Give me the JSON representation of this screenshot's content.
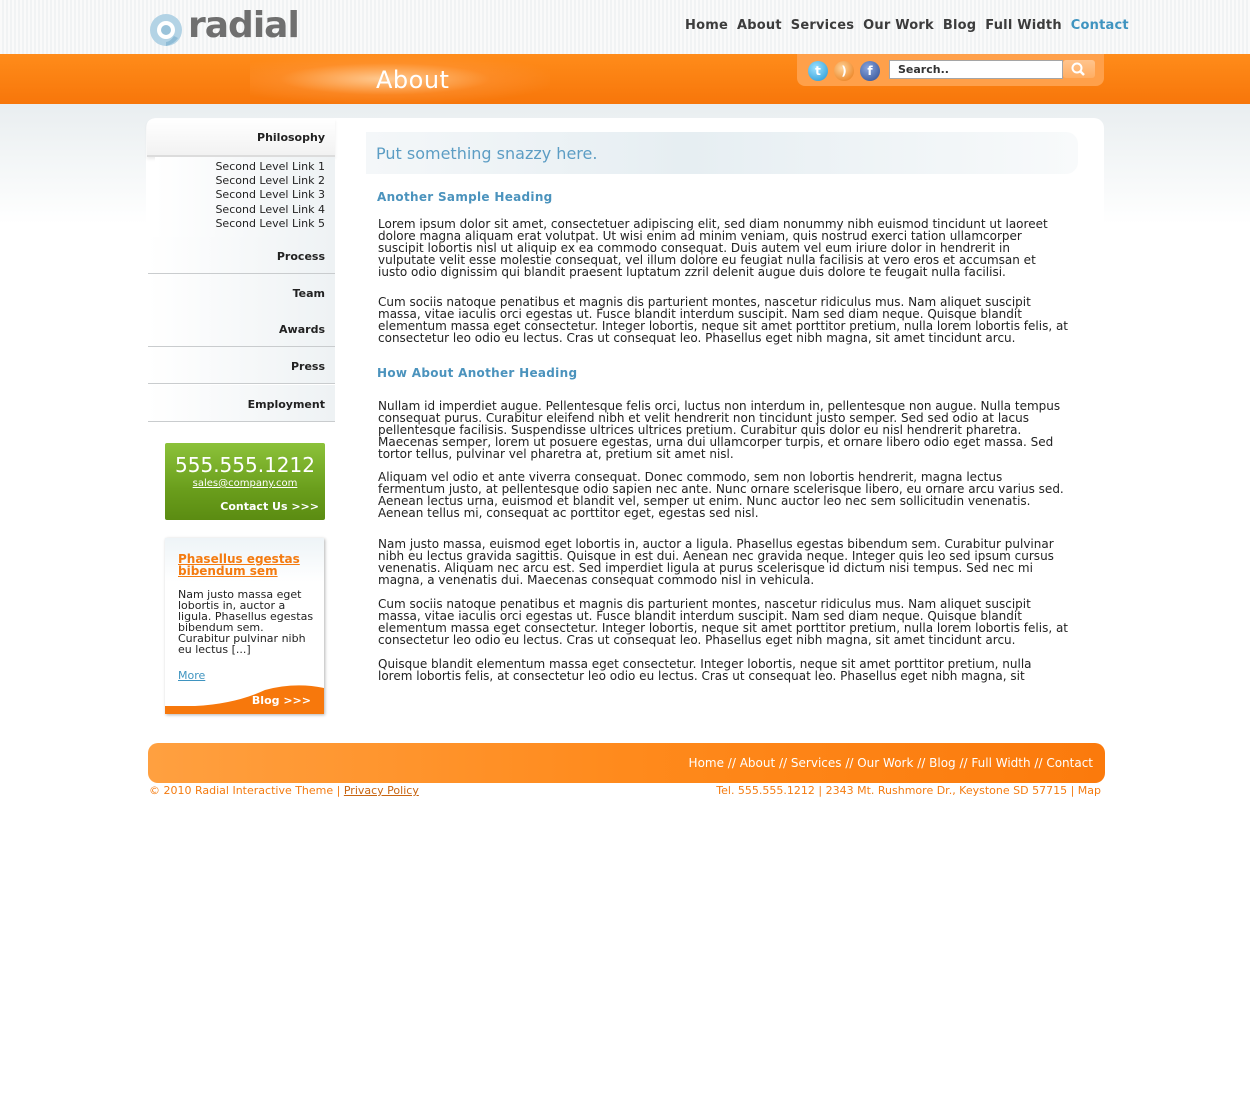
{
  "brand": {
    "name": "radial"
  },
  "topnav": [
    {
      "label": "Home"
    },
    {
      "label": "About"
    },
    {
      "label": "Services"
    },
    {
      "label": "Our Work"
    },
    {
      "label": "Blog"
    },
    {
      "label": "Full Width"
    },
    {
      "label": "Contact"
    }
  ],
  "page_title": "About",
  "search": {
    "placeholder": "Search.."
  },
  "sidebar": {
    "active": "Philosophy",
    "sub_links": [
      "Second Level Link 1",
      "Second Level Link 2",
      "Second Level Link 3",
      "Second Level Link 4",
      "Second Level Link 5"
    ],
    "items": [
      "Process",
      "Team",
      "Awards",
      "Press",
      "Employment"
    ]
  },
  "contact_box": {
    "phone": "555.555.1212",
    "email": "sales@company.com",
    "link": "Contact Us >>>"
  },
  "blog_box": {
    "title": "Phasellus egestas bibendum sem",
    "text": "Nam justo massa eget lobortis in, auctor a ligula. Phasellus egestas bibendum sem. Curabitur pulvinar nibh eu lectus [...]",
    "more": "More",
    "link": "Blog >>>"
  },
  "main": {
    "tagline": "Put something snazzy here.",
    "heading1": "Another Sample Heading",
    "p1": "Lorem ipsum dolor sit amet, consectetuer adipiscing elit, sed diam nonummy nibh euismod tincidunt ut laoreet dolore magna aliquam erat volutpat. Ut wisi enim ad minim veniam, quis nostrud exerci tation ullamcorper suscipit lobortis nisl ut aliquip ex ea commodo consequat. Duis autem vel eum iriure dolor in hendrerit in vulputate velit esse molestie consequat, vel illum dolore eu feugiat nulla facilisis at vero eros et accumsan et iusto odio dignissim qui blandit praesent luptatum zzril delenit augue duis dolore te feugait nulla facilisi.",
    "p2": "Cum sociis natoque penatibus et magnis dis parturient montes, nascetur ridiculus mus. Nam aliquet suscipit massa, vitae iaculis orci egestas ut. Fusce blandit interdum suscipit. Nam sed diam neque. Quisque blandit elementum massa eget consectetur. Integer lobortis, neque sit amet porttitor pretium, nulla lorem lobortis felis, at consectetur leo odio eu lectus. Cras ut consequat leo. Phasellus eget nibh magna, sit amet tincidunt arcu.",
    "heading2": "How About Another Heading",
    "p3": "Nullam id imperdiet augue. Pellentesque felis orci, luctus non interdum in, pellentesque non augue. Nulla tempus consequat purus. Curabitur eleifend nibh et velit hendrerit non tincidunt justo semper. Sed sed odio at lacus pellentesque facilisis. Suspendisse ultrices ultrices pretium. Curabitur quis dolor eu nisl hendrerit pharetra. Maecenas semper, lorem ut posuere egestas, urna dui ullamcorper turpis, et ornare libero odio eget massa. Sed tortor tellus, pulvinar vel pharetra at, pretium sit amet nisl.",
    "p4": "Aliquam vel odio et ante viverra consequat. Donec commodo, sem non lobortis hendrerit, magna lectus fermentum justo, at pellentesque odio sapien nec ante. Nunc ornare scelerisque libero, eu ornare arcu varius sed. Aenean lectus urna, euismod et blandit vel, semper ut enim. Nunc auctor leo nec sem sollicitudin venenatis. Aenean tellus mi, consequat ac porttitor eget, egestas sed nisl.",
    "p5": "Nam justo massa, euismod eget lobortis in, auctor a ligula. Phasellus egestas bibendum sem. Curabitur pulvinar nibh eu lectus gravida sagittis. Quisque in est dui. Aenean nec gravida neque. Integer quis leo sed ipsum cursus venenatis. Aliquam nec arcu est. Sed imperdiet ligula at purus scelerisque id dictum nisi tempus. Sed nec mi magna, a venenatis dui. Maecenas consequat commodo nisl in vehicula.",
    "p6": "Cum sociis natoque penatibus et magnis dis parturient montes, nascetur ridiculus mus. Nam aliquet suscipit massa, vitae iaculis orci egestas ut. Fusce blandit interdum suscipit. Nam sed diam neque. Quisque blandit elementum massa eget consectetur. Integer lobortis, neque sit amet porttitor pretium, nulla lorem lobortis felis, at consectetur leo odio eu lectus. Cras ut consequat leo. Phasellus eget nibh magna, sit amet tincidunt arcu.",
    "p7": "Quisque blandit elementum massa eget consectetur. Integer lobortis, neque sit amet porttitor pretium, nulla lorem lobortis felis, at consectetur leo odio eu lectus. Cras ut consequat leo. Phasellus eget nibh magna, sit"
  },
  "footer": {
    "nav": [
      "Home",
      "About",
      "Services",
      "Our Work",
      "Blog",
      "Full Width",
      "Contact"
    ],
    "copyright": "© 2010 Radial Interactive Theme |",
    "privacy": "Privacy Policy",
    "contact": "Tel. 555.555.1212 | 2343 Mt. Rushmore Dr., Keystone SD 57715 | Map"
  },
  "colors": {
    "accent": "#f47b10",
    "link": "#3f94c0",
    "green": "#6a9e1c"
  }
}
